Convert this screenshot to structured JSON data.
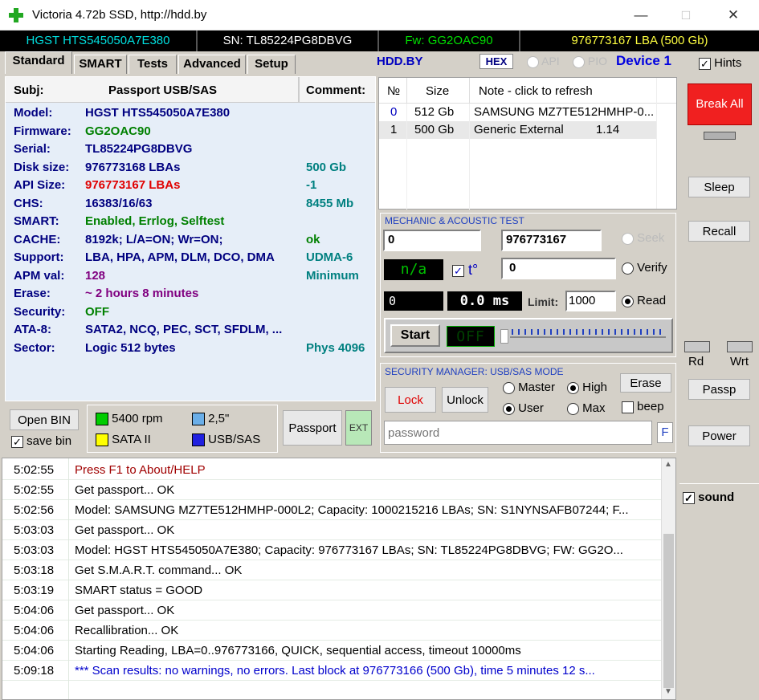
{
  "window": {
    "title": "Victoria 4.72b SSD, http://hdd.by"
  },
  "strip": {
    "model": "HGST HTS545050A7E380",
    "sn": "SN: TL85224PG8DBVG",
    "fw": "Fw: GG2OAC90",
    "lba": "976773167 LBA (500 Gb)"
  },
  "tabs": [
    "Standard",
    "SMART",
    "Tests",
    "Advanced",
    "Setup"
  ],
  "topbar": {
    "hddby": "HDD.BY",
    "hex": "HEX",
    "api": "API",
    "pio": "PIO",
    "device": "Device 1",
    "hints": "Hints"
  },
  "passport": {
    "header": {
      "subj": "Subj:",
      "title": "Passport USB/SAS",
      "comment": "Comment:"
    },
    "rows": [
      {
        "label": "Model:",
        "value": "HGST HTS545050A7E380",
        "comment": ""
      },
      {
        "label": "Firmware:",
        "value": "GG2OAC90",
        "comment": ""
      },
      {
        "label": "Serial:",
        "value": "TL85224PG8DBVG",
        "comment": ""
      },
      {
        "label": "Disk size:",
        "value": "976773168 LBAs",
        "comment": "500 Gb"
      },
      {
        "label": "API Size:",
        "value": "976773167 LBAs",
        "comment": "-1"
      },
      {
        "label": "CHS:",
        "value": "16383/16/63",
        "comment": "8455 Mb"
      },
      {
        "label": "SMART:",
        "value": "Enabled, Errlog, Selftest",
        "comment": ""
      },
      {
        "label": "CACHE:",
        "value": "8192k; L/A=ON; Wr=ON;",
        "comment": "ok"
      },
      {
        "label": "Support:",
        "value": "LBA, HPA, APM, DLM, DCO, DMA",
        "comment": "UDMA-6"
      },
      {
        "label": "APM val:",
        "value": "128",
        "comment": "Minimum"
      },
      {
        "label": "Erase:",
        "value": "~ 2 hours 8 minutes",
        "comment": ""
      },
      {
        "label": "Security:",
        "value": "OFF",
        "comment": ""
      },
      {
        "label": "ATA-8:",
        "value": "SATA2, NCQ, PEC, SCT, SFDLM, ...",
        "comment": ""
      },
      {
        "label": "Sector:",
        "value": "Logic 512 bytes",
        "comment": "Phys 4096"
      }
    ],
    "colors": {
      "label": "#000080",
      "model": "#000080",
      "firmware": "#008000",
      "api": "#e00000",
      "comment": "#008080",
      "apm": "#800080",
      "erase": "#800080",
      "green": "#008000"
    }
  },
  "drives": {
    "headers": {
      "no": "№",
      "size": "Size",
      "note": "Note - click to refresh"
    },
    "rows": [
      {
        "no": "0",
        "size": "512 Gb",
        "note": "SAMSUNG MZ7TE512HMHP-0...",
        "extra": ""
      },
      {
        "no": "1",
        "size": "500 Gb",
        "note": "Generic External",
        "extra": "1.14"
      }
    ]
  },
  "mechanic": {
    "title": "MECHANIC  &  ACOUSTIC TEST",
    "start_lba": "0",
    "end_lba": "976773167",
    "seek": "Seek",
    "na": "n/a",
    "t": "t°",
    "verify_value": "0",
    "verify": "Verify",
    "counter": "0",
    "ms": "0.0 ms",
    "limit_label": "Limit:",
    "limit_value": "1000",
    "read": "Read",
    "start": "Start",
    "off": "OFF"
  },
  "security": {
    "title": "SECURITY MANAGER: USB/SAS MODE",
    "lock": "Lock",
    "unlock": "Unlock",
    "master": "Master",
    "high": "High",
    "user": "User",
    "max": "Max",
    "erase": "Erase",
    "beep": "beep",
    "password_placeholder": "password",
    "f": "F"
  },
  "right": {
    "break_all": "Break All",
    "sleep": "Sleep",
    "recall": "Recall",
    "rd": "Rd",
    "wrt": "Wrt",
    "passp": "Passp",
    "power": "Power",
    "sound": "sound"
  },
  "bottom": {
    "open_bin": "Open BIN",
    "save_bin": "save bin",
    "legend": [
      {
        "label": "5400 rpm",
        "color": "#00cc00"
      },
      {
        "label": "2,5\"",
        "color": "#6aaee8"
      },
      {
        "label": "SATA II",
        "color": "#ffff00"
      },
      {
        "label": "USB/SAS",
        "color": "#2020e0"
      }
    ],
    "passport_btn": "Passport",
    "ext": "EXT"
  },
  "log": [
    {
      "time": "5:02:55",
      "msg": "Press F1 to About/HELP",
      "color": "#a00000"
    },
    {
      "time": "5:02:55",
      "msg": "Get passport... OK",
      "color": "#000000"
    },
    {
      "time": "5:02:56",
      "msg": "Model: SAMSUNG MZ7TE512HMHP-000L2; Capacity: 1000215216 LBAs; SN: S1NYNSAFB07244; F...",
      "color": "#000000"
    },
    {
      "time": "5:03:03",
      "msg": "Get passport... OK",
      "color": "#000000"
    },
    {
      "time": "5:03:03",
      "msg": "Model: HGST HTS545050A7E380; Capacity: 976773167 LBAs; SN: TL85224PG8DBVG; FW: GG2O...",
      "color": "#000000"
    },
    {
      "time": "5:03:18",
      "msg": "Get S.M.A.R.T. command... OK",
      "color": "#000000"
    },
    {
      "time": "5:03:19",
      "msg": "SMART status = GOOD",
      "color": "#000000"
    },
    {
      "time": "5:04:06",
      "msg": "Get passport... OK",
      "color": "#000000"
    },
    {
      "time": "5:04:06",
      "msg": "Recallibration... OK",
      "color": "#000000"
    },
    {
      "time": "5:04:06",
      "msg": "Starting Reading, LBA=0..976773166, QUICK, sequential access, timeout 10000ms",
      "color": "#000000"
    },
    {
      "time": "5:09:18",
      "msg": "*** Scan results: no warnings, no errors. Last block at 976773166 (500 Gb), time 5 minutes 12 s...",
      "color": "#0000cc"
    }
  ]
}
